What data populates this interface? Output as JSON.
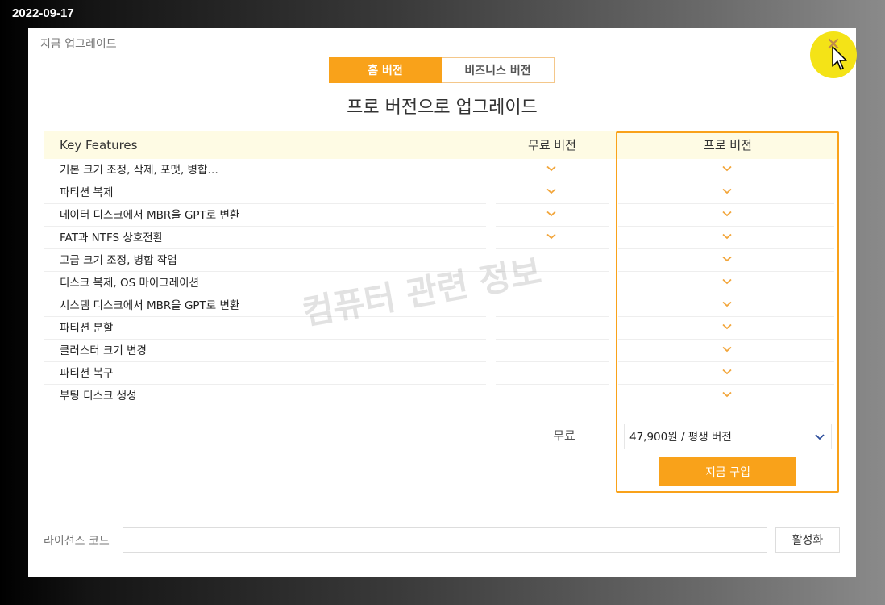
{
  "date_stamp": "2022-09-17",
  "dialog": {
    "title": "지금 업그레이드",
    "close_icon": "close-icon"
  },
  "tabs": [
    {
      "label": "홈 버전",
      "active": true
    },
    {
      "label": "비즈니스 버전",
      "active": false
    }
  ],
  "heading": "프로 버전으로 업그레이드",
  "table": {
    "headers": {
      "feature": "Key Features",
      "free": "무료 버전",
      "pro": "프로 버전"
    },
    "rows": [
      {
        "feature": "기본 크기 조정, 삭제, 포맷, 병합…",
        "free": true,
        "pro": true
      },
      {
        "feature": "파티션 복제",
        "free": true,
        "pro": true
      },
      {
        "feature": "데이터 디스크에서 MBR을 GPT로 변환",
        "free": true,
        "pro": true
      },
      {
        "feature": "FAT과 NTFS 상호전환",
        "free": true,
        "pro": true
      },
      {
        "feature": "고급 크기 조정, 병합 작업",
        "free": false,
        "pro": true
      },
      {
        "feature": "디스크 복제, OS 마이그레이션",
        "free": false,
        "pro": true
      },
      {
        "feature": "시스템 디스크에서 MBR을 GPT로 변환",
        "free": false,
        "pro": true
      },
      {
        "feature": "파티션 분할",
        "free": false,
        "pro": true
      },
      {
        "feature": "클러스터 크기 변경",
        "free": false,
        "pro": true
      },
      {
        "feature": "파티션 복구",
        "free": false,
        "pro": true
      },
      {
        "feature": "부팅 디스크 생성",
        "free": false,
        "pro": true
      }
    ]
  },
  "free_price": "무료",
  "pro_price_option": "47,900원 / 평생 버전",
  "buy_label": "지금 구입",
  "watermark": "컴퓨터 관련 정보",
  "license": {
    "label": "라이선스 코드",
    "value": "",
    "activate_label": "활성화"
  },
  "colors": {
    "accent": "#f9a21a",
    "header_bg": "#fefbe4",
    "check": "#f2a53a"
  }
}
